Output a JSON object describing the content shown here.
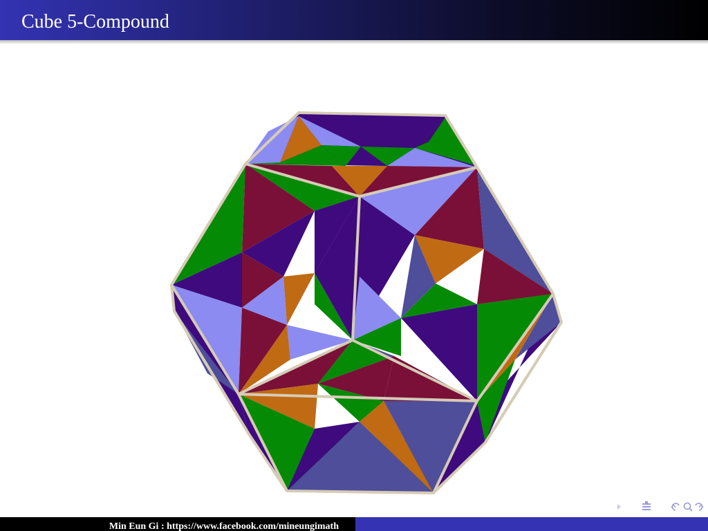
{
  "frame": {
    "title": "Cube 5-Compound"
  },
  "footer": {
    "text": "Min Eun Gi : https://www.facebook.com/mineungimath"
  },
  "navigation": {
    "icons": [
      "nav-arrow-icon",
      "nav-section-icon",
      "nav-back-icon",
      "nav-zoom-icon",
      "nav-forward-icon"
    ]
  },
  "colors": {
    "title_bar": "#3333b3",
    "footer_right": "#3333b3",
    "footer_left": "#000000",
    "face_green": "#058a05",
    "face_light_blue": "#8b8bf2",
    "face_dark_purple": "#3e0a7e",
    "face_orange": "#c06a14",
    "face_maroon": "#7a1037",
    "face_slate": "#4e4e9a",
    "wire": "#d6cbb6"
  }
}
